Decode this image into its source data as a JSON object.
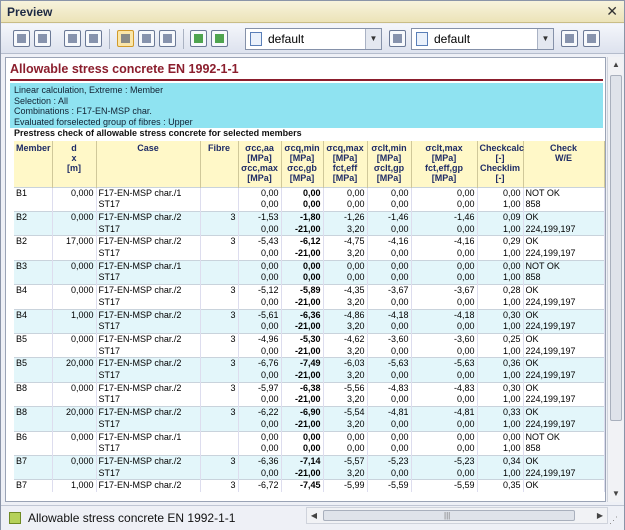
{
  "window": {
    "title": "Preview",
    "close": "✕"
  },
  "toolbar": {
    "combo1": {
      "value": "default",
      "arrow": "▼"
    },
    "combo2": {
      "value": "default",
      "arrow": "▼"
    }
  },
  "report": {
    "title": "Allowable stress concrete EN 1992-1-1",
    "info": [
      "Linear calculation, Extreme : Member",
      "Selection : All",
      "Combinations : F17-EN-MSP char.",
      "Evaluated forselected group of fibres : Upper"
    ],
    "subtitle": "Prestress check of allowable stress concrete for selected members",
    "headers": {
      "member": "Member",
      "dx": "d",
      "dx_sub": "x",
      "dx_unit": "[m]",
      "case": "Case",
      "fibre": "Fibre",
      "col1a": "σcc,aa [MPa]",
      "col1b": "σcc,max [MPa]",
      "col2a": "σcq,min [MPa]",
      "col2b": "σcc,gb [MPa]",
      "col3a": "σcq,max [MPa]",
      "col3b": "fct,eff [MPa]",
      "col4a": "σclt,min [MPa]",
      "col4b": "σclt,gp [MPa]",
      "col5a": "σclt,max [MPa]",
      "col5b": "fct,eff,gp [MPa]",
      "col6a": "Checkcalc [-]",
      "col6b": "Checklim [-]",
      "col7a": "Check",
      "col7b": "W/E"
    },
    "rows": [
      [
        "B1",
        "0,000",
        "F17-EN-MSP char./1",
        "",
        "0,00",
        "0,00",
        "0,00",
        "0,00",
        "0,00",
        "0,00",
        "NOT OK"
      ],
      [
        "",
        "",
        "ST17",
        "",
        "0,00",
        "0,00",
        "0,00",
        "0,00",
        "0,00",
        "1,00",
        "858"
      ],
      [
        "B2",
        "0,000",
        "F17-EN-MSP char./2",
        "3",
        "-1,53",
        "-1,80",
        "-1,26",
        "-1,46",
        "-1,46",
        "0,09",
        "OK"
      ],
      [
        "",
        "",
        "ST17",
        "",
        "0,00",
        "-21,00",
        "3,20",
        "0,00",
        "0,00",
        "1,00",
        "224,199,197"
      ],
      [
        "B2",
        "17,000",
        "F17-EN-MSP char./2",
        "3",
        "-5,43",
        "-6,12",
        "-4,75",
        "-4,16",
        "-4,16",
        "0,29",
        "OK"
      ],
      [
        "",
        "",
        "ST17",
        "",
        "0,00",
        "-21,00",
        "3,20",
        "0,00",
        "0,00",
        "1,00",
        "224,199,197"
      ],
      [
        "B3",
        "0,000",
        "F17-EN-MSP char./1",
        "",
        "0,00",
        "0,00",
        "0,00",
        "0,00",
        "0,00",
        "0,00",
        "NOT OK"
      ],
      [
        "",
        "",
        "ST17",
        "",
        "0,00",
        "0,00",
        "0,00",
        "0,00",
        "0,00",
        "1,00",
        "858"
      ],
      [
        "B4",
        "0,000",
        "F17-EN-MSP char./2",
        "3",
        "-5,12",
        "-5,89",
        "-4,35",
        "-3,67",
        "-3,67",
        "0,28",
        "OK"
      ],
      [
        "",
        "",
        "ST17",
        "",
        "0,00",
        "-21,00",
        "3,20",
        "0,00",
        "0,00",
        "1,00",
        "224,199,197"
      ],
      [
        "B4",
        "1,000",
        "F17-EN-MSP char./2",
        "3",
        "-5,61",
        "-6,36",
        "-4,86",
        "-4,18",
        "-4,18",
        "0,30",
        "OK"
      ],
      [
        "",
        "",
        "ST17",
        "",
        "0,00",
        "-21,00",
        "3,20",
        "0,00",
        "0,00",
        "1,00",
        "224,199,197"
      ],
      [
        "B5",
        "0,000",
        "F17-EN-MSP char./2",
        "3",
        "-4,96",
        "-5,30",
        "-4,62",
        "-3,60",
        "-3,60",
        "0,25",
        "OK"
      ],
      [
        "",
        "",
        "ST17",
        "",
        "0,00",
        "-21,00",
        "3,20",
        "0,00",
        "0,00",
        "1,00",
        "224,199,197"
      ],
      [
        "B5",
        "20,000",
        "F17-EN-MSP char./2",
        "3",
        "-6,76",
        "-7,49",
        "-6,03",
        "-5,63",
        "-5,63",
        "0,36",
        "OK"
      ],
      [
        "",
        "",
        "ST17",
        "",
        "0,00",
        "-21,00",
        "3,20",
        "0,00",
        "0,00",
        "1,00",
        "224,199,197"
      ],
      [
        "B8",
        "0,000",
        "F17-EN-MSP char./2",
        "3",
        "-5,97",
        "-6,38",
        "-5,56",
        "-4,83",
        "-4,83",
        "0,30",
        "OK"
      ],
      [
        "",
        "",
        "ST17",
        "",
        "0,00",
        "-21,00",
        "3,20",
        "0,00",
        "0,00",
        "1,00",
        "224,199,197"
      ],
      [
        "B8",
        "20,000",
        "F17-EN-MSP char./2",
        "3",
        "-6,22",
        "-6,90",
        "-5,54",
        "-4,81",
        "-4,81",
        "0,33",
        "OK"
      ],
      [
        "",
        "",
        "ST17",
        "",
        "0,00",
        "-21,00",
        "3,20",
        "0,00",
        "0,00",
        "1,00",
        "224,199,197"
      ],
      [
        "B6",
        "0,000",
        "F17-EN-MSP char./1",
        "",
        "0,00",
        "0,00",
        "0,00",
        "0,00",
        "0,00",
        "0,00",
        "NOT OK"
      ],
      [
        "",
        "",
        "ST17",
        "",
        "0,00",
        "0,00",
        "0,00",
        "0,00",
        "0,00",
        "1,00",
        "858"
      ],
      [
        "B7",
        "0,000",
        "F17-EN-MSP char./2",
        "3",
        "-6,36",
        "-7,14",
        "-5,57",
        "-5,23",
        "-5,23",
        "0,34",
        "OK"
      ],
      [
        "",
        "",
        "ST17",
        "",
        "0,00",
        "-21,00",
        "3,20",
        "0,00",
        "0,00",
        "1,00",
        "224,199,197"
      ],
      [
        "B7",
        "1,000",
        "F17-EN-MSP char./2",
        "3",
        "-6,72",
        "-7,45",
        "-5,99",
        "-5,59",
        "-5,59",
        "0,35",
        "OK"
      ]
    ]
  },
  "status": {
    "label": "Allowable stress concrete EN 1992-1-1"
  },
  "scroll": {
    "up": "▲",
    "down": "▼",
    "left": "◀",
    "right": "▶",
    "grip": "|||",
    "resize": "⋰"
  }
}
